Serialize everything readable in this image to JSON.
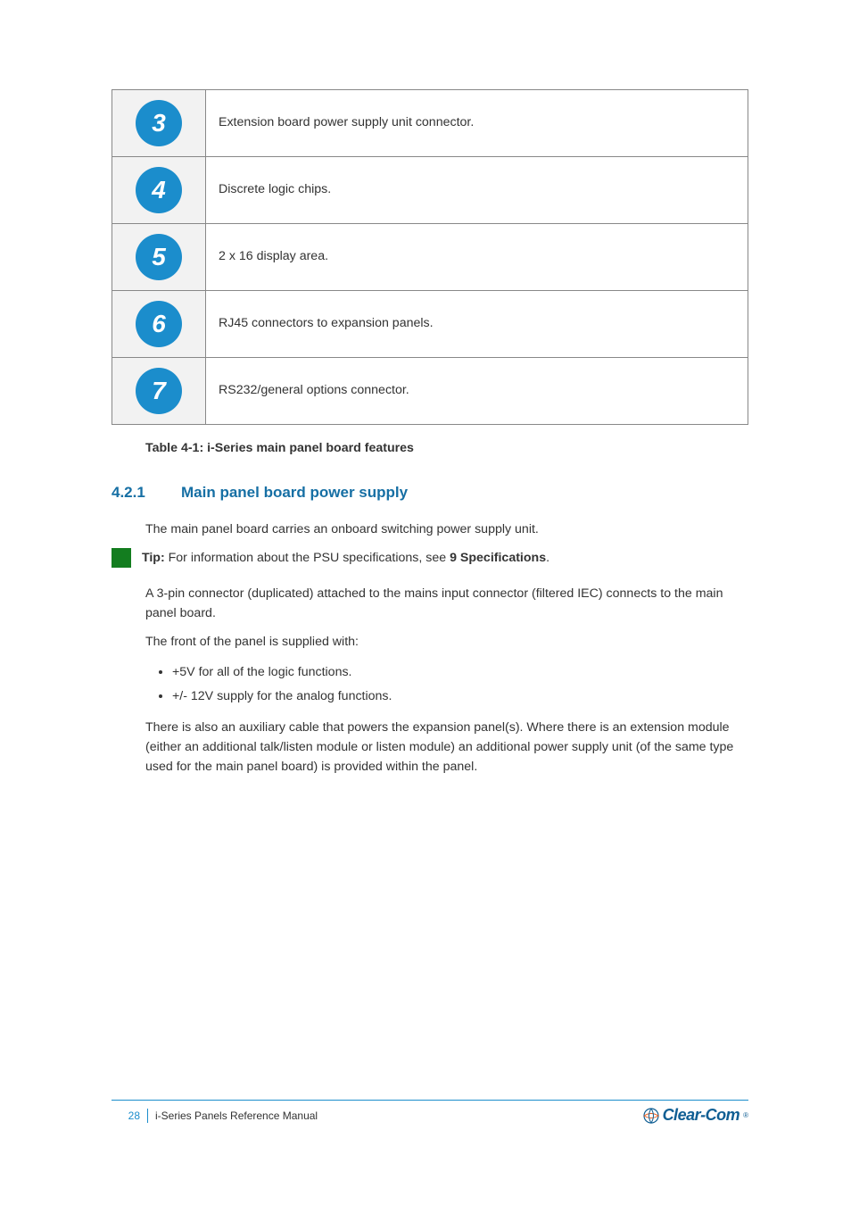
{
  "table": {
    "rows": [
      {
        "num": "3",
        "desc": "Extension board power supply unit connector."
      },
      {
        "num": "4",
        "desc": "Discrete logic chips."
      },
      {
        "num": "5",
        "desc": "2 x 16 display area."
      },
      {
        "num": "6",
        "desc": "RJ45 connectors to expansion panels."
      },
      {
        "num": "7",
        "desc": "RS232/general options connector."
      }
    ]
  },
  "caption": "Table 4-1: i-Series main panel board features",
  "section": {
    "num": "4.2.1",
    "title": "Main panel board power supply"
  },
  "para1": "The main panel board carries an onboard switching power supply unit.",
  "tipLabel": " Tip:",
  "tipText": " For information about the PSU specifications, see ",
  "tipLinkBold": "9 Specifications",
  "tipAfter": ".",
  "para2": "A 3-pin connector (duplicated) attached to the mains input connector (filtered IEC) connects to the main panel board.",
  "para3": "The front of the panel is supplied with:",
  "bullets": [
    "+5V for all of the logic functions.",
    "+/- 12V supply for the analog functions."
  ],
  "para4": "There is also an auxiliary cable that powers the expansion panel(s). Where there is an extension module (either an additional talk/listen module or listen module) an additional power supply unit (of the same type used for the main panel board) is provided within the panel.",
  "footer": {
    "page": "28",
    "title": "i-Series Panels Reference Manual",
    "brand": "Clear-Com"
  }
}
